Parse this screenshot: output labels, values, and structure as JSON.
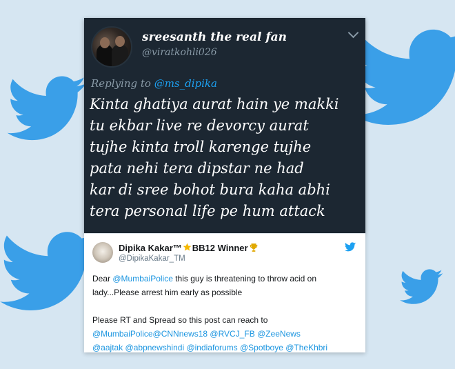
{
  "dark_tweet": {
    "name": "sreesanth the real fan",
    "handle": "@viratkohli026",
    "replying_prefix": "Replying to ",
    "replying_to": "@ms_dipika",
    "lines": [
      "Kinta ghatiya aurat hain ye makki",
      "tu ekbar live re devorcy aurat",
      "tujhe kinta troll karenge tujhe",
      "pata nehi tera dipstar ne had",
      "kar di sree bohot bura kaha abhi",
      "tera personal life pe hum attack"
    ]
  },
  "light_tweet": {
    "name": "Dipika Kakar™",
    "name_badge": "BB12 Winner",
    "handle": "@DipikaKakar_TM",
    "p1_prefix": "Dear ",
    "p1_mention": "@MumbaiPolice",
    "p1_rest": " this guy is threatening to throw acid on lady...Please arrest him early as possible",
    "p2_text": "Please RT and Spread so this post can reach to",
    "mentions_line1": "@MumbaiPolice@CNNnews18 @RVCJ_FB @ZeeNews",
    "mentions_line2": "@aajtak @abpnewshindi @indiaforums @Spotboye @TheKhbri"
  },
  "icons": {
    "background": "twitter-bird-icon",
    "star": "star-icon",
    "trophy": "trophy-icon",
    "more": "chevron-down-icon"
  },
  "colors": {
    "background": "#d6e6f2",
    "dark_card": "#1c2732",
    "twitter_blue": "#1da1f2",
    "bird_bg": "#3a9fe8"
  }
}
